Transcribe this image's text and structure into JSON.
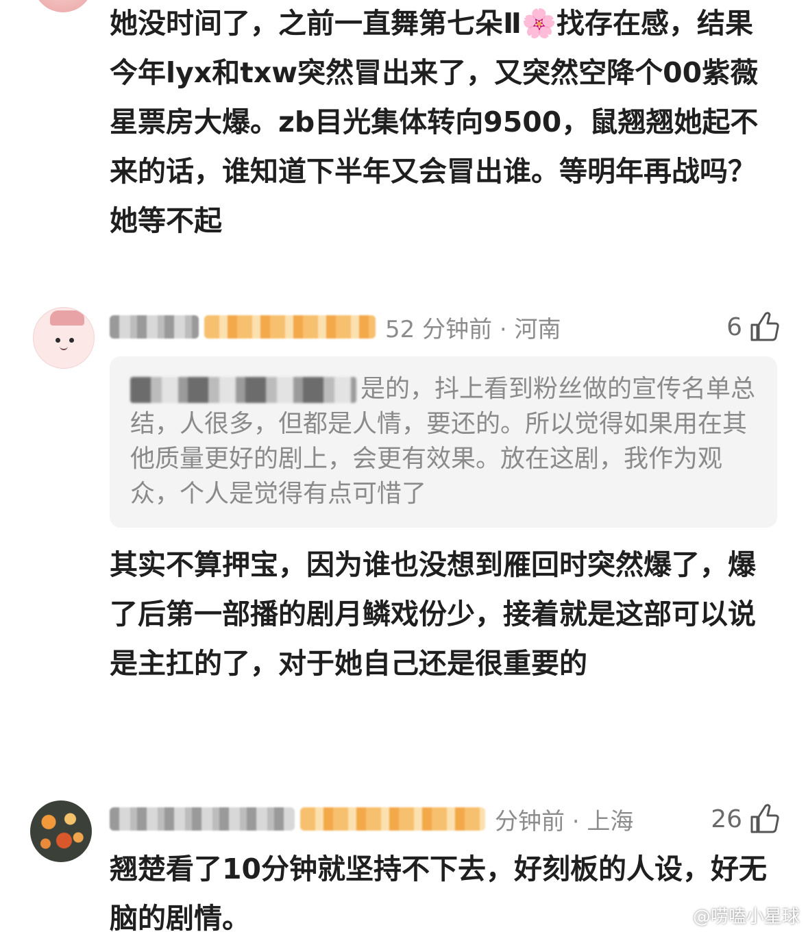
{
  "comments": [
    {
      "text": "她没时间了，之前一直舞第七朵Ⅱ🌸找存在感，结果今年lyx和txw突然冒出来了，又突然空降个00紫薇星票房大爆。zb目光集体转向9500，鼠翘翘她起不来的话，谁知道下半年又会冒出谁。等明年再战吗？她等不起"
    },
    {
      "time_location": "52 分钟前 · 河南",
      "likes": "6",
      "quote_text": "是的，抖上看到粉丝做的宣传名单总结，人很多，但都是人情，要还的。所以觉得如果用在其他质量更好的剧上，会更有效果。放在这剧，我作为观众，个人是觉得有点可惜了",
      "text": "其实不算押宝，因为谁也没想到雁回时突然爆了，爆了后第一部播的剧月鳞戏份少，接着就是这部可以说是主扛的了，对于她自己还是很重要的"
    },
    {
      "time_location": "分钟前 · 上海",
      "likes": "26",
      "text": "翘楚看了10分钟就坚持不下去，好刻板的人设，好无脑的剧情。"
    }
  ],
  "watermark": "@唠嗑小星球",
  "icons": {
    "like": "thumbs-up-icon",
    "weibo": "weibo-logo-icon"
  },
  "colors": {
    "text": "#1f1f1f",
    "meta": "#8c8c8c",
    "quote_bg": "#f4f4f4",
    "quote_text": "#8a8a8a"
  }
}
